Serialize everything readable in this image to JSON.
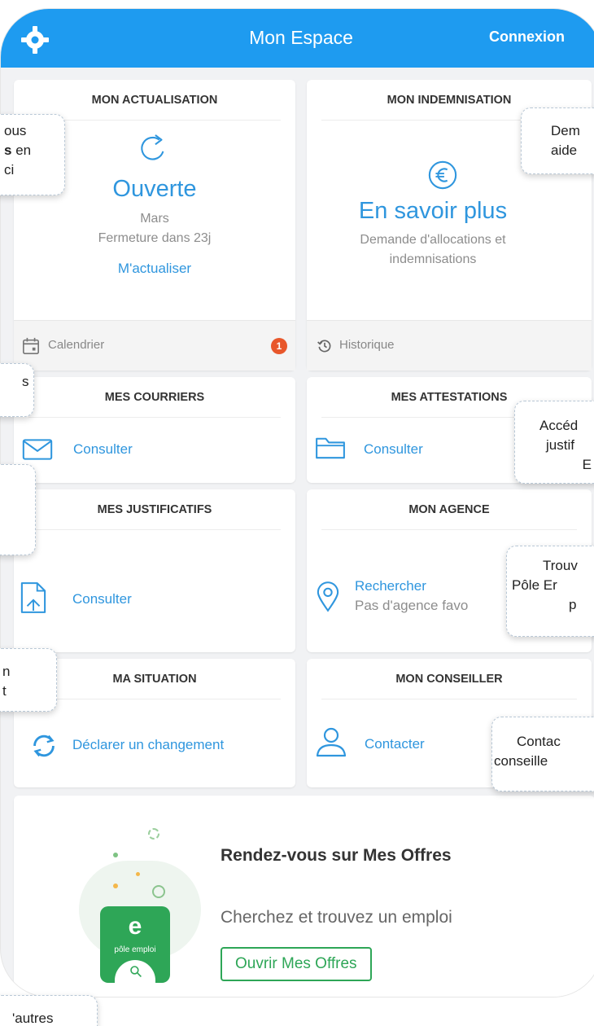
{
  "header": {
    "title": "Mon Espace",
    "login_label": "Connexion"
  },
  "actualisation": {
    "title": "MON ACTUALISATION",
    "status": "Ouverte",
    "month": "Mars",
    "closing": "Fermeture dans 23j",
    "action": "M'actualiser",
    "calendar_label": "Calendrier",
    "badge": "1"
  },
  "indemnisation": {
    "title": "MON INDEMNISATION",
    "cta": "En savoir plus",
    "desc_line1": "Demande d'allocations et",
    "desc_line2": "indemnisations",
    "history_label": "Historique"
  },
  "courriers": {
    "title": "MES COURRIERS",
    "action": "Consulter"
  },
  "attestations": {
    "title": "MES ATTESTATIONS",
    "action": "Consulter"
  },
  "justificatifs": {
    "title": "MES JUSTIFICATIFS",
    "action": "Consulter"
  },
  "agence": {
    "title": "MON AGENCE",
    "action": "Rechercher",
    "sub": "Pas d'agence favo"
  },
  "situation": {
    "title": "MA SITUATION",
    "action": "Déclarer un changement"
  },
  "conseiller": {
    "title": "MON CONSEILLER",
    "action": "Contacter"
  },
  "offres": {
    "title": "Rendez-vous sur Mes Offres",
    "desc": "Cherchez et trouvez un emploi",
    "button": "Ouvrir Mes Offres",
    "logo_text": "pôle emploi",
    "logo_letter": "e"
  },
  "tips": {
    "t1_line1": "ous",
    "t1_bold": "s",
    "t1_after": " en",
    "t1_line3": "ci",
    "t2_line1": "Dem",
    "t2_line2": "aide",
    "t3": "s",
    "t4_line1": "Accéd",
    "t4_line2": "justif",
    "t4_line3": "E",
    "t5_line1": "Trouv",
    "t5_line2": "Pôle Er",
    "t5_line3": "p",
    "t6_line1": "n",
    "t6_line2": "t",
    "t7_line1": "Contac",
    "t7_line2": "conseille",
    "t8": "'autres"
  },
  "colors": {
    "brand_blue": "#1e9bf0",
    "link_blue": "#2f96de",
    "badge_red": "#e8572b",
    "pe_green": "#2ea657"
  }
}
